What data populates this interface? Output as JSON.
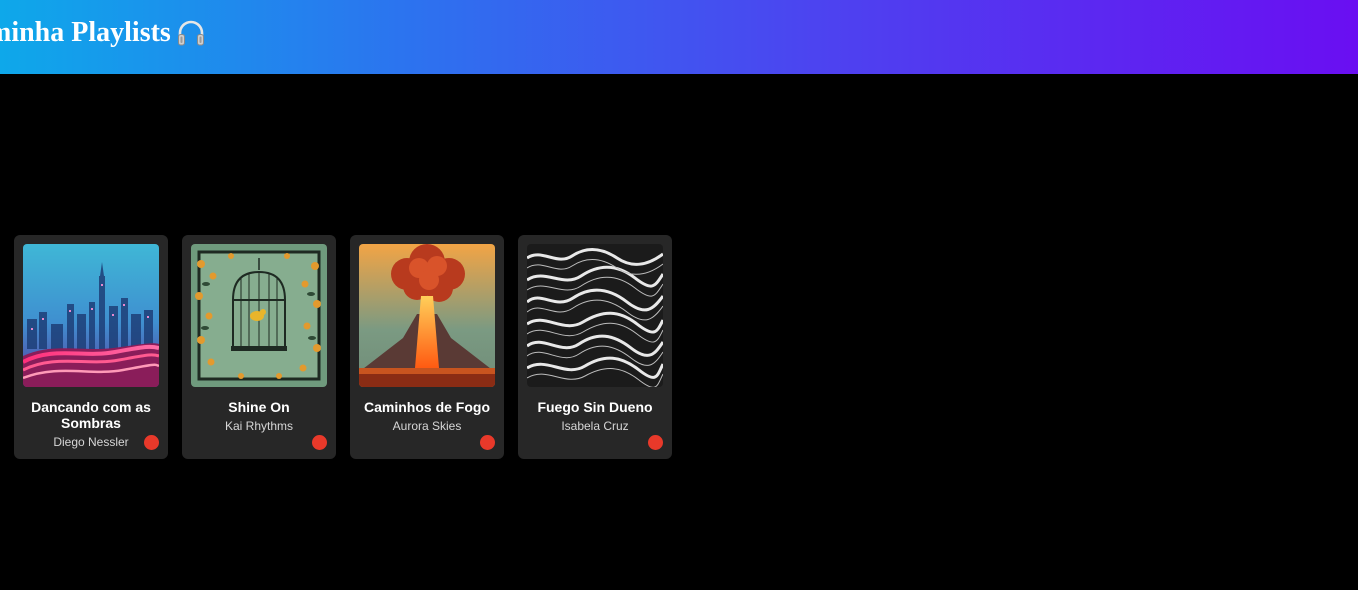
{
  "header": {
    "title": "minha Playlists",
    "icon": "headphones-icon"
  },
  "colors": {
    "header_gradient_start": "#0ea8ea",
    "header_gradient_end": "#6a0ef2",
    "card_background": "#272727",
    "play_button": "#e8392a"
  },
  "playlists": [
    {
      "title": "Dancando com as Sombras",
      "artist": "Diego Nessler",
      "cover": "neon-city-cover"
    },
    {
      "title": "Shine On",
      "artist": "Kai Rhythms",
      "cover": "birdcage-flowers-cover"
    },
    {
      "title": "Caminhos de Fogo",
      "artist": "Aurora Skies",
      "cover": "volcano-eruption-cover"
    },
    {
      "title": "Fuego Sin Dueno",
      "artist": "Isabela Cruz",
      "cover": "wave-lines-cover"
    }
  ]
}
